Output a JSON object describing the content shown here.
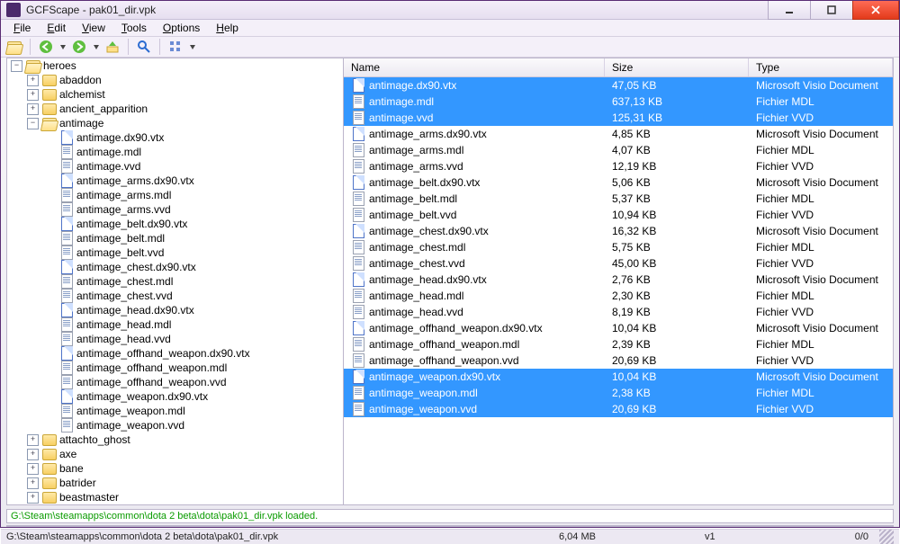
{
  "window": {
    "title": "GCFScape - pak01_dir.vpk"
  },
  "menu": {
    "file": "File",
    "edit": "Edit",
    "view": "View",
    "tools": "Tools",
    "options": "Options",
    "help": "Help"
  },
  "tree": {
    "root": "heroes",
    "folders": [
      {
        "name": "abaddon",
        "expanded": false
      },
      {
        "name": "alchemist",
        "expanded": false
      },
      {
        "name": "ancient_apparition",
        "expanded": false
      },
      {
        "name": "antimage",
        "expanded": true,
        "files": [
          {
            "name": "antimage.dx90.vtx",
            "kind": "vsd"
          },
          {
            "name": "antimage.mdl",
            "kind": "doc"
          },
          {
            "name": "antimage.vvd",
            "kind": "doc"
          },
          {
            "name": "antimage_arms.dx90.vtx",
            "kind": "vsd"
          },
          {
            "name": "antimage_arms.mdl",
            "kind": "doc"
          },
          {
            "name": "antimage_arms.vvd",
            "kind": "doc"
          },
          {
            "name": "antimage_belt.dx90.vtx",
            "kind": "vsd"
          },
          {
            "name": "antimage_belt.mdl",
            "kind": "doc"
          },
          {
            "name": "antimage_belt.vvd",
            "kind": "doc"
          },
          {
            "name": "antimage_chest.dx90.vtx",
            "kind": "vsd"
          },
          {
            "name": "antimage_chest.mdl",
            "kind": "doc"
          },
          {
            "name": "antimage_chest.vvd",
            "kind": "doc"
          },
          {
            "name": "antimage_head.dx90.vtx",
            "kind": "vsd"
          },
          {
            "name": "antimage_head.mdl",
            "kind": "doc"
          },
          {
            "name": "antimage_head.vvd",
            "kind": "doc"
          },
          {
            "name": "antimage_offhand_weapon.dx90.vtx",
            "kind": "vsd"
          },
          {
            "name": "antimage_offhand_weapon.mdl",
            "kind": "doc"
          },
          {
            "name": "antimage_offhand_weapon.vvd",
            "kind": "doc"
          },
          {
            "name": "antimage_weapon.dx90.vtx",
            "kind": "vsd"
          },
          {
            "name": "antimage_weapon.mdl",
            "kind": "doc"
          },
          {
            "name": "antimage_weapon.vvd",
            "kind": "doc"
          }
        ]
      },
      {
        "name": "attachto_ghost",
        "expanded": false
      },
      {
        "name": "axe",
        "expanded": false
      },
      {
        "name": "bane",
        "expanded": false
      },
      {
        "name": "batrider",
        "expanded": false
      },
      {
        "name": "beastmaster",
        "expanded": false
      }
    ]
  },
  "list": {
    "headers": {
      "name": "Name",
      "size": "Size",
      "type": "Type"
    },
    "rows": [
      {
        "name": "antimage.dx90.vtx",
        "size": "47,05 KB",
        "type": "Microsoft Visio Document",
        "kind": "vsd",
        "selected": true
      },
      {
        "name": "antimage.mdl",
        "size": "637,13 KB",
        "type": "Fichier MDL",
        "kind": "doc",
        "selected": true
      },
      {
        "name": "antimage.vvd",
        "size": "125,31 KB",
        "type": "Fichier VVD",
        "kind": "doc",
        "selected": true
      },
      {
        "name": "antimage_arms.dx90.vtx",
        "size": "4,85 KB",
        "type": "Microsoft Visio Document",
        "kind": "vsd",
        "selected": false
      },
      {
        "name": "antimage_arms.mdl",
        "size": "4,07 KB",
        "type": "Fichier MDL",
        "kind": "doc",
        "selected": false
      },
      {
        "name": "antimage_arms.vvd",
        "size": "12,19 KB",
        "type": "Fichier VVD",
        "kind": "doc",
        "selected": false
      },
      {
        "name": "antimage_belt.dx90.vtx",
        "size": "5,06 KB",
        "type": "Microsoft Visio Document",
        "kind": "vsd",
        "selected": false
      },
      {
        "name": "antimage_belt.mdl",
        "size": "5,37 KB",
        "type": "Fichier MDL",
        "kind": "doc",
        "selected": false
      },
      {
        "name": "antimage_belt.vvd",
        "size": "10,94 KB",
        "type": "Fichier VVD",
        "kind": "doc",
        "selected": false
      },
      {
        "name": "antimage_chest.dx90.vtx",
        "size": "16,32 KB",
        "type": "Microsoft Visio Document",
        "kind": "vsd",
        "selected": false
      },
      {
        "name": "antimage_chest.mdl",
        "size": "5,75 KB",
        "type": "Fichier MDL",
        "kind": "doc",
        "selected": false
      },
      {
        "name": "antimage_chest.vvd",
        "size": "45,00 KB",
        "type": "Fichier VVD",
        "kind": "doc",
        "selected": false
      },
      {
        "name": "antimage_head.dx90.vtx",
        "size": "2,76 KB",
        "type": "Microsoft Visio Document",
        "kind": "vsd",
        "selected": false
      },
      {
        "name": "antimage_head.mdl",
        "size": "2,30 KB",
        "type": "Fichier MDL",
        "kind": "doc",
        "selected": false
      },
      {
        "name": "antimage_head.vvd",
        "size": "8,19 KB",
        "type": "Fichier VVD",
        "kind": "doc",
        "selected": false
      },
      {
        "name": "antimage_offhand_weapon.dx90.vtx",
        "size": "10,04 KB",
        "type": "Microsoft Visio Document",
        "kind": "vsd",
        "selected": false
      },
      {
        "name": "antimage_offhand_weapon.mdl",
        "size": "2,39 KB",
        "type": "Fichier MDL",
        "kind": "doc",
        "selected": false
      },
      {
        "name": "antimage_offhand_weapon.vvd",
        "size": "20,69 KB",
        "type": "Fichier VVD",
        "kind": "doc",
        "selected": false
      },
      {
        "name": "antimage_weapon.dx90.vtx",
        "size": "10,04 KB",
        "type": "Microsoft Visio Document",
        "kind": "vsd",
        "selected": true
      },
      {
        "name": "antimage_weapon.mdl",
        "size": "2,38 KB",
        "type": "Fichier MDL",
        "kind": "doc",
        "selected": true
      },
      {
        "name": "antimage_weapon.vvd",
        "size": "20,69 KB",
        "type": "Fichier VVD",
        "kind": "doc",
        "selected": true
      }
    ]
  },
  "log": "G:\\Steam\\steamapps\\common\\dota 2 beta\\dota\\pak01_dir.vpk loaded.",
  "status": {
    "path": "G:\\Steam\\steamapps\\common\\dota 2 beta\\dota\\pak01_dir.vpk",
    "size": "6,04 MB",
    "version": "v1",
    "progress": "0/0"
  }
}
